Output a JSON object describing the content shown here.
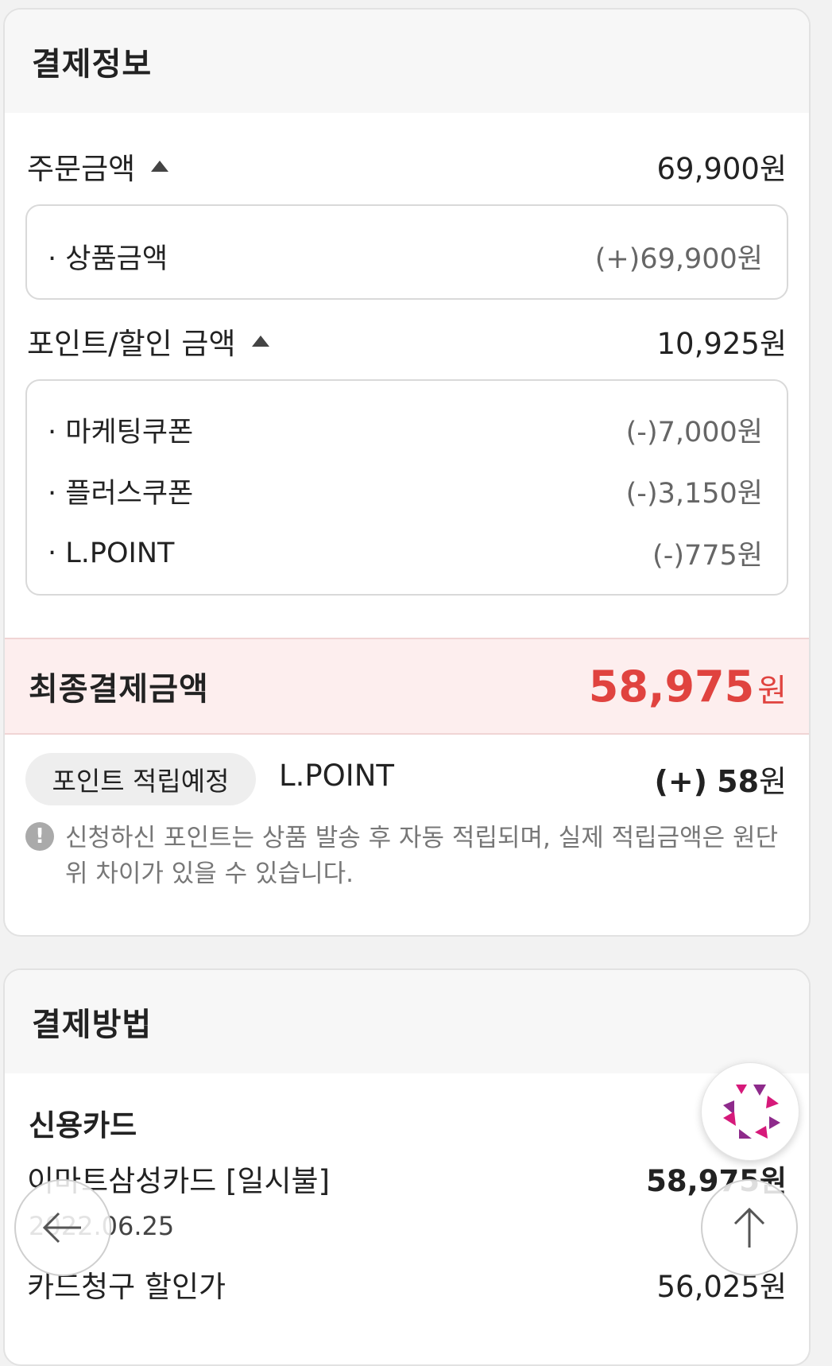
{
  "payment_info": {
    "title": "결제정보",
    "order_amount": {
      "label": "주문금액",
      "value": "69,900원"
    },
    "order_items": [
      {
        "label": "· 상품금액",
        "value": "(+)69,900원"
      }
    ],
    "discount_amount": {
      "label": "포인트/할인 금액",
      "value": "10,925원"
    },
    "discount_items": [
      {
        "label": "· 마케팅쿠폰",
        "value": "(-)7,000원"
      },
      {
        "label": "· 플러스쿠폰",
        "value": "(-)3,150원"
      },
      {
        "label": "· L.POINT",
        "value": "(-)775원"
      }
    ],
    "final": {
      "label": "최종결제금액",
      "amount": "58,975",
      "unit": "원"
    },
    "point_accrual": {
      "badge": "포인트 적립예정",
      "name": "L.POINT",
      "prefix": "(+)",
      "amount": "58",
      "unit": "원"
    },
    "notice_icon": "!",
    "notice": "신청하신 포인트는 상품 발송 후 자동 적립되며, 실제 적립금액은 원단위 차이가 있을 수 있습니다."
  },
  "payment_method": {
    "title": "결제방법",
    "type": "신용카드",
    "card_name": "이마트삼성카드 [일시불]",
    "card_amount": "58,975원",
    "date": "2022.06.25",
    "card_discount": {
      "label": "카드청구 할인가",
      "value": "56,025원"
    }
  },
  "floating": {
    "back_icon": "arrow-left-icon",
    "top_icon": "arrow-up-icon",
    "logo_icon": "chat-logo-icon"
  },
  "colors": {
    "accent_red": "#e0433f",
    "final_bg": "#fdeeee",
    "logo_magenta": "#d6197a",
    "logo_purple": "#8e2a8b"
  }
}
